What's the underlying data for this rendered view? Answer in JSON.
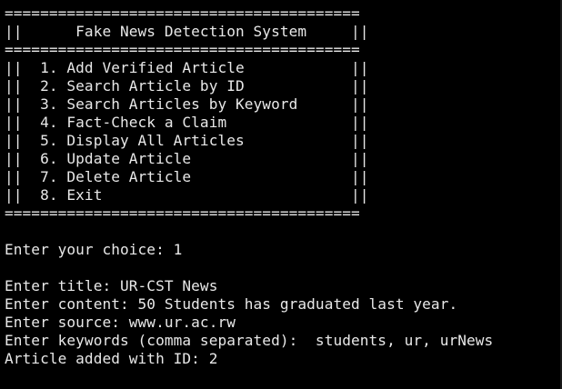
{
  "colors": {
    "background": "#000000",
    "text": "#e8e8e8"
  },
  "menu": {
    "top_border": "========================================",
    "title_row": "||      Fake News Detection System     ||",
    "mid_border": "========================================",
    "items": [
      "||  1. Add Verified Article            ||",
      "||  2. Search Article by ID            ||",
      "||  3. Search Articles by Keyword      ||",
      "||  4. Fact-Check a Claim              ||",
      "||  5. Display All Articles            ||",
      "||  6. Update Article                  ||",
      "||  7. Delete Article                  ||",
      "||  8. Exit                            ||"
    ],
    "bottom_border": "========================================"
  },
  "session": {
    "choice_prompt": "Enter your choice: 1",
    "title_prompt": "Enter title: UR-CST News",
    "content_prompt": "Enter content: 50 Students has graduated last year.",
    "source_prompt": "Enter source: www.ur.ac.rw",
    "keywords_prompt": "Enter keywords (comma separated):  students, ur, urNews",
    "result": "Article added with ID: 2"
  }
}
